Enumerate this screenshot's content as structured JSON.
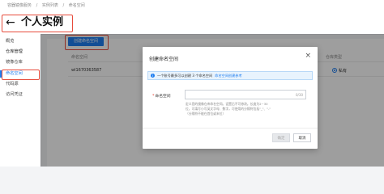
{
  "breadcrumb": [
    "容器镜像服务",
    "实例列表",
    "命名空间"
  ],
  "page": {
    "title": "个人实例"
  },
  "sidebar": {
    "overview": "概览",
    "group": "仓库管理",
    "items": [
      "镜像仓库",
      "命名空间",
      "代码源",
      "访问凭证"
    ],
    "active": "命名空间"
  },
  "toolbar": {
    "create_label": "创建命名空间"
  },
  "table": {
    "columns": {
      "name": "命名空间",
      "type": "仓库类型"
    },
    "rows": [
      {
        "name": "wl1670363587",
        "type": "私有"
      }
    ]
  },
  "modal": {
    "title": "创建命名空间",
    "close": "×",
    "info_text": "一个账号最多可以创建 3 个命名空间",
    "info_link": "命名空间创建参考",
    "field_label": "命名空间",
    "counter": "0/30",
    "help": [
      "定义您的镜像仓库命名空间。设置后不可修改。长度为2~30",
      "位，可填写小写英文字母、数字，可使用的分隔符包括\"_\"、\"-\"",
      "（分隔符不能在首位或末位）"
    ],
    "ok": "确定",
    "cancel": "取消"
  }
}
